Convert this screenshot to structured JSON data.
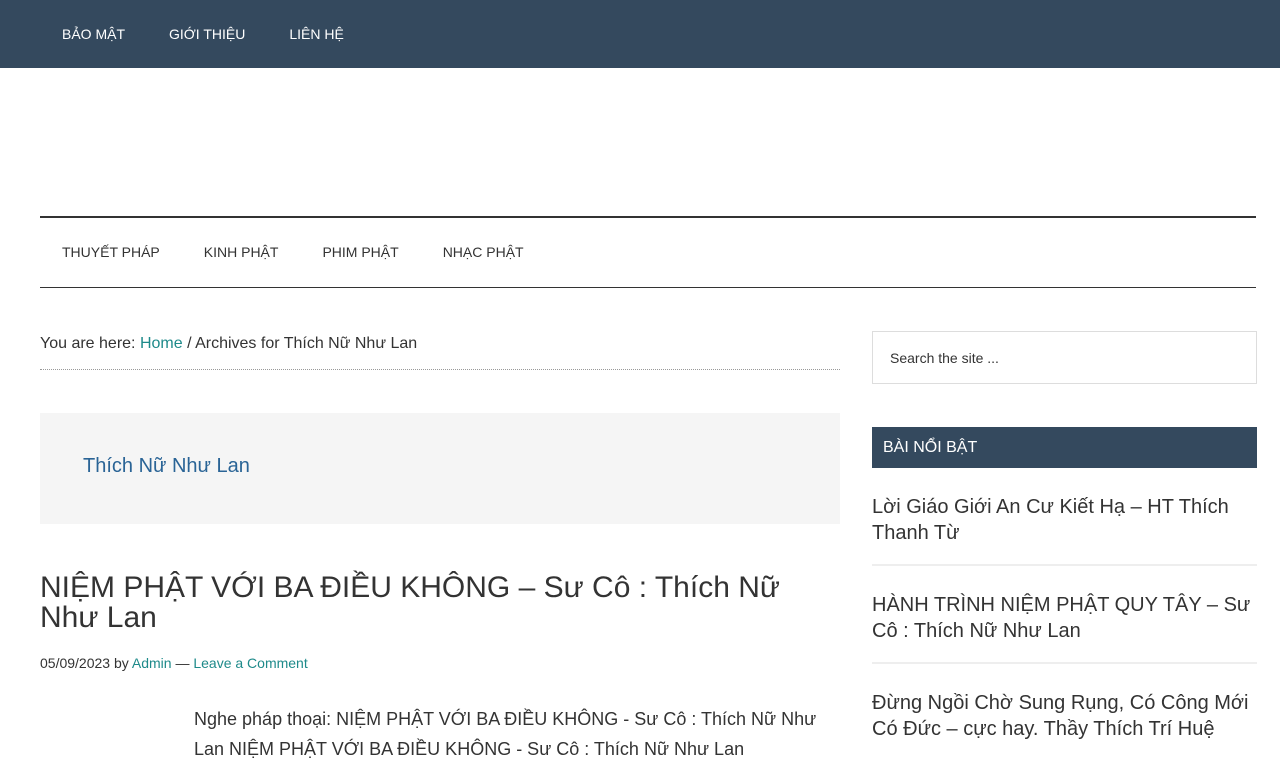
{
  "top_nav": {
    "items": [
      {
        "label": "BẢO MẬT"
      },
      {
        "label": "GIỚI THIỆU"
      },
      {
        "label": "LIÊN HỆ"
      }
    ]
  },
  "primary_nav": {
    "items": [
      {
        "label": "THUYẾT PHÁP"
      },
      {
        "label": "KINH PHẬT"
      },
      {
        "label": "PHIM PHẬT"
      },
      {
        "label": "NHẠC PHẬT"
      }
    ]
  },
  "breadcrumb": {
    "prefix": "You are here: ",
    "home": "Home",
    "separator": " / ",
    "current": "Archives for Thích Nữ Như Lan"
  },
  "archive": {
    "title": "Thích Nữ Như Lan"
  },
  "post": {
    "title": "NIỆM PHẬT VỚI BA ĐIỀU KHÔNG – Sư Cô : Thích Nữ Như Lan",
    "date": "05/09/2023",
    "by": " by ",
    "author": "Admin",
    "dash": " — ",
    "comment_link": "Leave a Comment",
    "excerpt": "Nghe pháp thoại: NIỆM PHẬT VỚI BA ĐIỀU KHÔNG - Sư Cô : Thích Nữ Như Lan NIỆM PHẬT VỚI BA ĐIỀU KHÔNG - Sư Cô : Thích Nữ Như Lan"
  },
  "sidebar": {
    "search_placeholder": "Search the site ...",
    "widget_title": "BÀI NỔI BẬT",
    "featured": [
      {
        "title": "Lời Giáo Giới An Cư Kiết Hạ – HT Thích Thanh Từ"
      },
      {
        "title": "HÀNH TRÌNH NIỆM PHẬT QUY TÂY – Sư Cô : Thích Nữ Như Lan"
      },
      {
        "title": "Đừng Ngồi Chờ Sung Rụng, Có Công Mới Có Đức – cực hay. Thầy Thích Trí Huệ"
      }
    ]
  },
  "colors": {
    "nav_bg": "#34495e",
    "link": "#1e8a8a",
    "archive_title": "#2a6496",
    "archive_bg": "#f5f5f5"
  }
}
